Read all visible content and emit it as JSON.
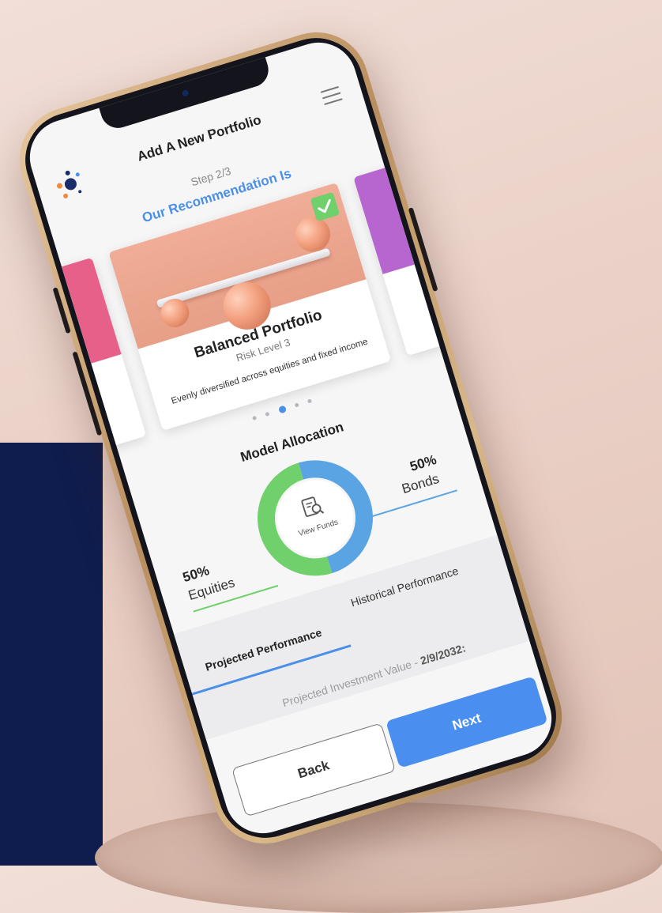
{
  "header": {
    "title": "Add A New Portfolio"
  },
  "step": {
    "label": "Step 2/3"
  },
  "recommendation": {
    "heading": "Our Recommendation Is"
  },
  "card": {
    "name": "Balanced Portfolio",
    "risk": "Risk Level 3",
    "description": "Evenly diversified across equities and fixed income",
    "selected": true
  },
  "pager": {
    "count": 5,
    "active": 3
  },
  "allocation": {
    "title": "Model Allocation",
    "equities": {
      "pct": "50%",
      "label": "Equities",
      "color": "#6fd06c"
    },
    "bonds": {
      "pct": "50%",
      "label": "Bonds",
      "color": "#5aa4e4"
    },
    "center_label": "View Funds"
  },
  "tabs": {
    "projected": "Projected Performance",
    "historical": "Historical Performance"
  },
  "projection": {
    "label": "Projected Investment Value - ",
    "date": "2/9/2032:"
  },
  "buttons": {
    "back": "Back",
    "next": "Next"
  },
  "colors": {
    "accent": "#4a90e8",
    "navy": "#0f1d4e",
    "left_card": "#e7608a",
    "right_card": "#b866cf"
  },
  "icons": {
    "logo": "logo-icon",
    "menu": "hamburger-menu-icon",
    "check": "check-icon",
    "funds": "document-search-icon"
  }
}
